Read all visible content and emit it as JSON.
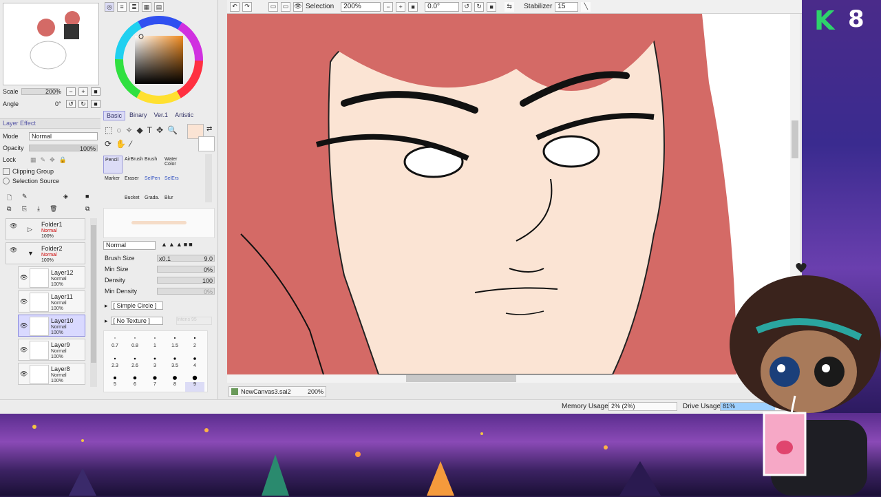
{
  "app": {
    "toolbar": {
      "selection_label": "Selection",
      "zoom": "200%",
      "rotation": "0.0°",
      "stabilizer_label": "Stabilizer",
      "stabilizer_value": "15"
    },
    "tab": {
      "filename": "NewCanvas3.sai2",
      "zoom": "200%"
    },
    "status": {
      "memory_label": "Memory Usage",
      "memory_value": "2% (2%)",
      "drive_label": "Drive Usage",
      "drive_value": "81%"
    }
  },
  "left_panel": {
    "scale_label": "Scale",
    "scale_value": "200%",
    "angle_label": "Angle",
    "angle_value": "0°",
    "layer_effect": "Layer Effect",
    "mode_label": "Mode",
    "mode_value": "Normal",
    "opacity_label": "Opacity",
    "opacity_value": "100%",
    "lock_label": "Lock",
    "clipping_group": "Clipping Group",
    "selection_source": "Selection Source",
    "folders": [
      {
        "name": "Folder1",
        "mode": "Normal",
        "opacity": "100%"
      },
      {
        "name": "Folder2",
        "mode": "Normal",
        "opacity": "100%"
      }
    ],
    "layers": [
      {
        "name": "Layer12",
        "mode": "Normal",
        "opacity": "100%"
      },
      {
        "name": "Layer11",
        "mode": "Normal",
        "opacity": "100%"
      },
      {
        "name": "Layer10",
        "mode": "Normal",
        "opacity": "100%"
      },
      {
        "name": "Layer9",
        "mode": "Normal",
        "opacity": "100%"
      },
      {
        "name": "Layer8",
        "mode": "Normal",
        "opacity": "100%"
      }
    ]
  },
  "tools_panel": {
    "color_tabs": [
      "Basic",
      "Binary",
      "Ver.1",
      "Artistic"
    ],
    "tools": [
      "Pencil",
      "AirBrush",
      "Brush",
      "Water Color",
      "Marker",
      "Eraser",
      "SelPen",
      "SelErs",
      "Bucket",
      "Grada.",
      "Blur"
    ],
    "blend_mode": "Normal",
    "brush_size_label": "Brush Size",
    "brush_size_mult": "x0.1",
    "brush_size_value": "9.0",
    "min_size_label": "Min Size",
    "min_size_value": "0%",
    "density_label": "Density",
    "density_value": "100",
    "min_density_label": "Min Density",
    "min_density_value": "0%",
    "shape_label": "[ Simple Circle ]",
    "texture_label": "[ No Texture ]",
    "texture_strength": "Intens 95",
    "brush_sizes": [
      "0.7",
      "0.8",
      "1",
      "1.5",
      "2",
      "2.3",
      "2.6",
      "3",
      "3.5",
      "4",
      "5",
      "6",
      "7",
      "8",
      "9"
    ]
  },
  "stream": {
    "badge_letter": "K",
    "badge_number": "8"
  },
  "colors": {
    "hair": "#d46a66",
    "skin": "#fbe4d4",
    "accent": "#2ed36b"
  }
}
